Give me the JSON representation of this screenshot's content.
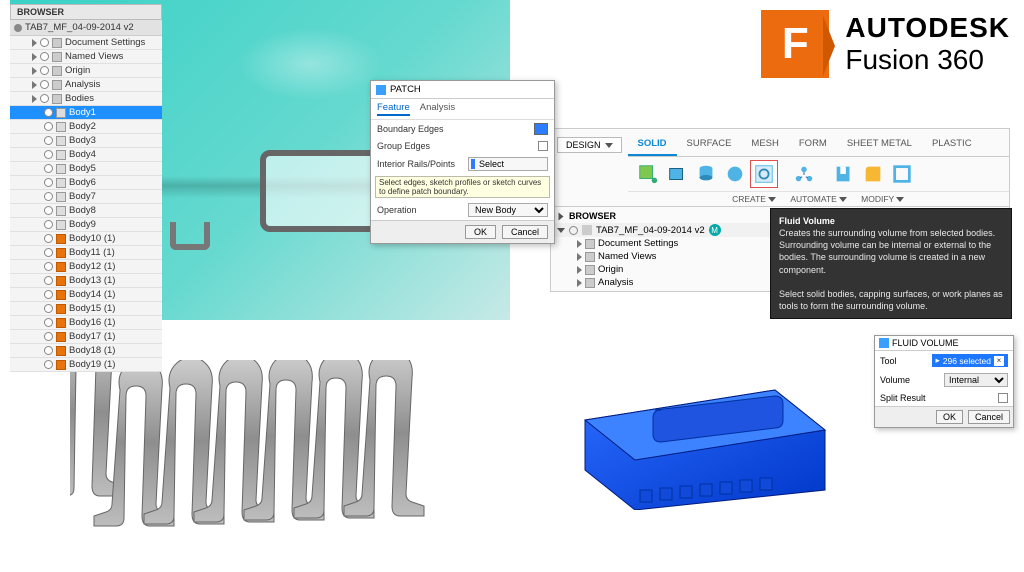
{
  "brand": {
    "logo_letter": "F",
    "line1": "AUTODESK",
    "line2": "Fusion 360"
  },
  "top_left_browser": {
    "title": "BROWSER",
    "file_name": "TAB7_MF_04-09-2014 v2",
    "folders": [
      {
        "label": "Document Settings"
      },
      {
        "label": "Named Views"
      },
      {
        "label": "Origin"
      },
      {
        "label": "Analysis"
      },
      {
        "label": "Bodies"
      }
    ],
    "bodies": [
      {
        "label": "Body1",
        "selected": true,
        "kind": "cube"
      },
      {
        "label": "Body2",
        "kind": "cube"
      },
      {
        "label": "Body3",
        "kind": "cube"
      },
      {
        "label": "Body4",
        "kind": "cube"
      },
      {
        "label": "Body5",
        "kind": "cube"
      },
      {
        "label": "Body6",
        "kind": "cube"
      },
      {
        "label": "Body7",
        "kind": "cube"
      },
      {
        "label": "Body8",
        "kind": "cube"
      },
      {
        "label": "Body9",
        "kind": "cube"
      },
      {
        "label": "Body10 (1)",
        "kind": "orange"
      },
      {
        "label": "Body11 (1)",
        "kind": "orange"
      },
      {
        "label": "Body12 (1)",
        "kind": "orange"
      },
      {
        "label": "Body13 (1)",
        "kind": "orange"
      },
      {
        "label": "Body14 (1)",
        "kind": "orange"
      },
      {
        "label": "Body15 (1)",
        "kind": "orange"
      },
      {
        "label": "Body16 (1)",
        "kind": "orange"
      },
      {
        "label": "Body17 (1)",
        "kind": "orange"
      },
      {
        "label": "Body18 (1)",
        "kind": "orange"
      },
      {
        "label": "Body19 (1)",
        "kind": "orange"
      }
    ]
  },
  "patch_dialog": {
    "title": "PATCH",
    "tab_feature": "Feature",
    "tab_analysis": "Analysis",
    "row_boundary": "Boundary Edges",
    "row_group": "Group Edges",
    "row_interior": "Interior Rails/Points",
    "interior_btn": "Select",
    "row_operation": "Operation",
    "operation_value": "New Body",
    "tooltip": "Select edges, sketch profiles or sketch curves to define patch boundary.",
    "ok": "OK",
    "cancel": "Cancel"
  },
  "ribbon": {
    "tabs": [
      "SOLID",
      "SURFACE",
      "MESH",
      "FORM",
      "SHEET METAL",
      "PLASTIC"
    ],
    "design_btn": "DESIGN",
    "group_create": "CREATE",
    "group_automate": "AUTOMATE",
    "group_modify": "MODIFY",
    "browser_title": "BROWSER",
    "file_name": "TAB7_MF_04-09-2014 v2",
    "entries": [
      {
        "label": "Document Settings"
      },
      {
        "label": "Named Views"
      },
      {
        "label": "Origin"
      },
      {
        "label": "Analysis"
      }
    ]
  },
  "tooltip_fluid": {
    "title": "Fluid Volume",
    "body1": "Creates the surrounding volume from selected bodies. Surrounding volume can be internal or external to the bodies. The surrounding volume is created in a new component.",
    "body2": "Select solid bodies, capping surfaces, or work planes as tools to form the surrounding volume."
  },
  "fluid_dialog": {
    "title": "FLUID VOLUME",
    "row_tool": "Tool",
    "selection": "296 selected",
    "row_volume": "Volume",
    "volume_value": "Internal",
    "row_split": "Split Result",
    "ok": "OK",
    "cancel": "Cancel"
  }
}
